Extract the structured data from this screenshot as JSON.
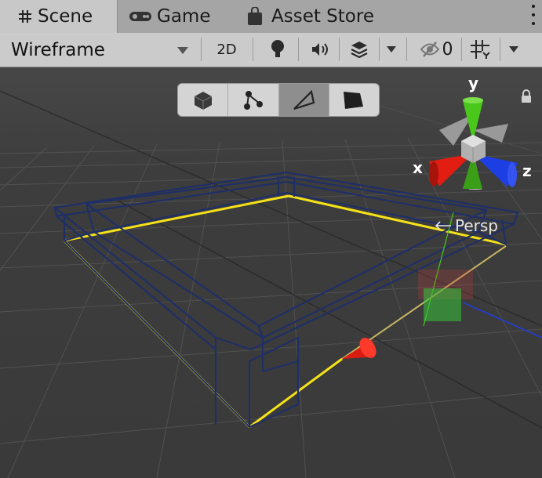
{
  "tabs": [
    {
      "label": "Scene",
      "icon": "grid-icon",
      "active": true
    },
    {
      "label": "Game",
      "icon": "gamepad-icon",
      "active": false
    },
    {
      "label": "Asset Store",
      "icon": "shopping-bag-icon",
      "active": false
    }
  ],
  "toolbar": {
    "draw_mode": "Wireframe",
    "toggle_2d": "2D",
    "hidden_count": "0",
    "icons": [
      "lightbulb-icon",
      "audio-icon",
      "effects-icon",
      "visibility-icon",
      "gizmos-icon"
    ]
  },
  "shading_modes": [
    "shaded-cube-icon",
    "vertex-icon",
    "wireframe-icon",
    "shaded-icon"
  ],
  "gizmo": {
    "x_label": "x",
    "y_label": "y",
    "z_label": "z",
    "projection": "Persp"
  },
  "colors": {
    "selection": "#f5e21a",
    "wire": "#1f2f66",
    "axis_x": "#e21d12",
    "axis_y": "#49c81b",
    "axis_z": "#1d3ee3"
  }
}
